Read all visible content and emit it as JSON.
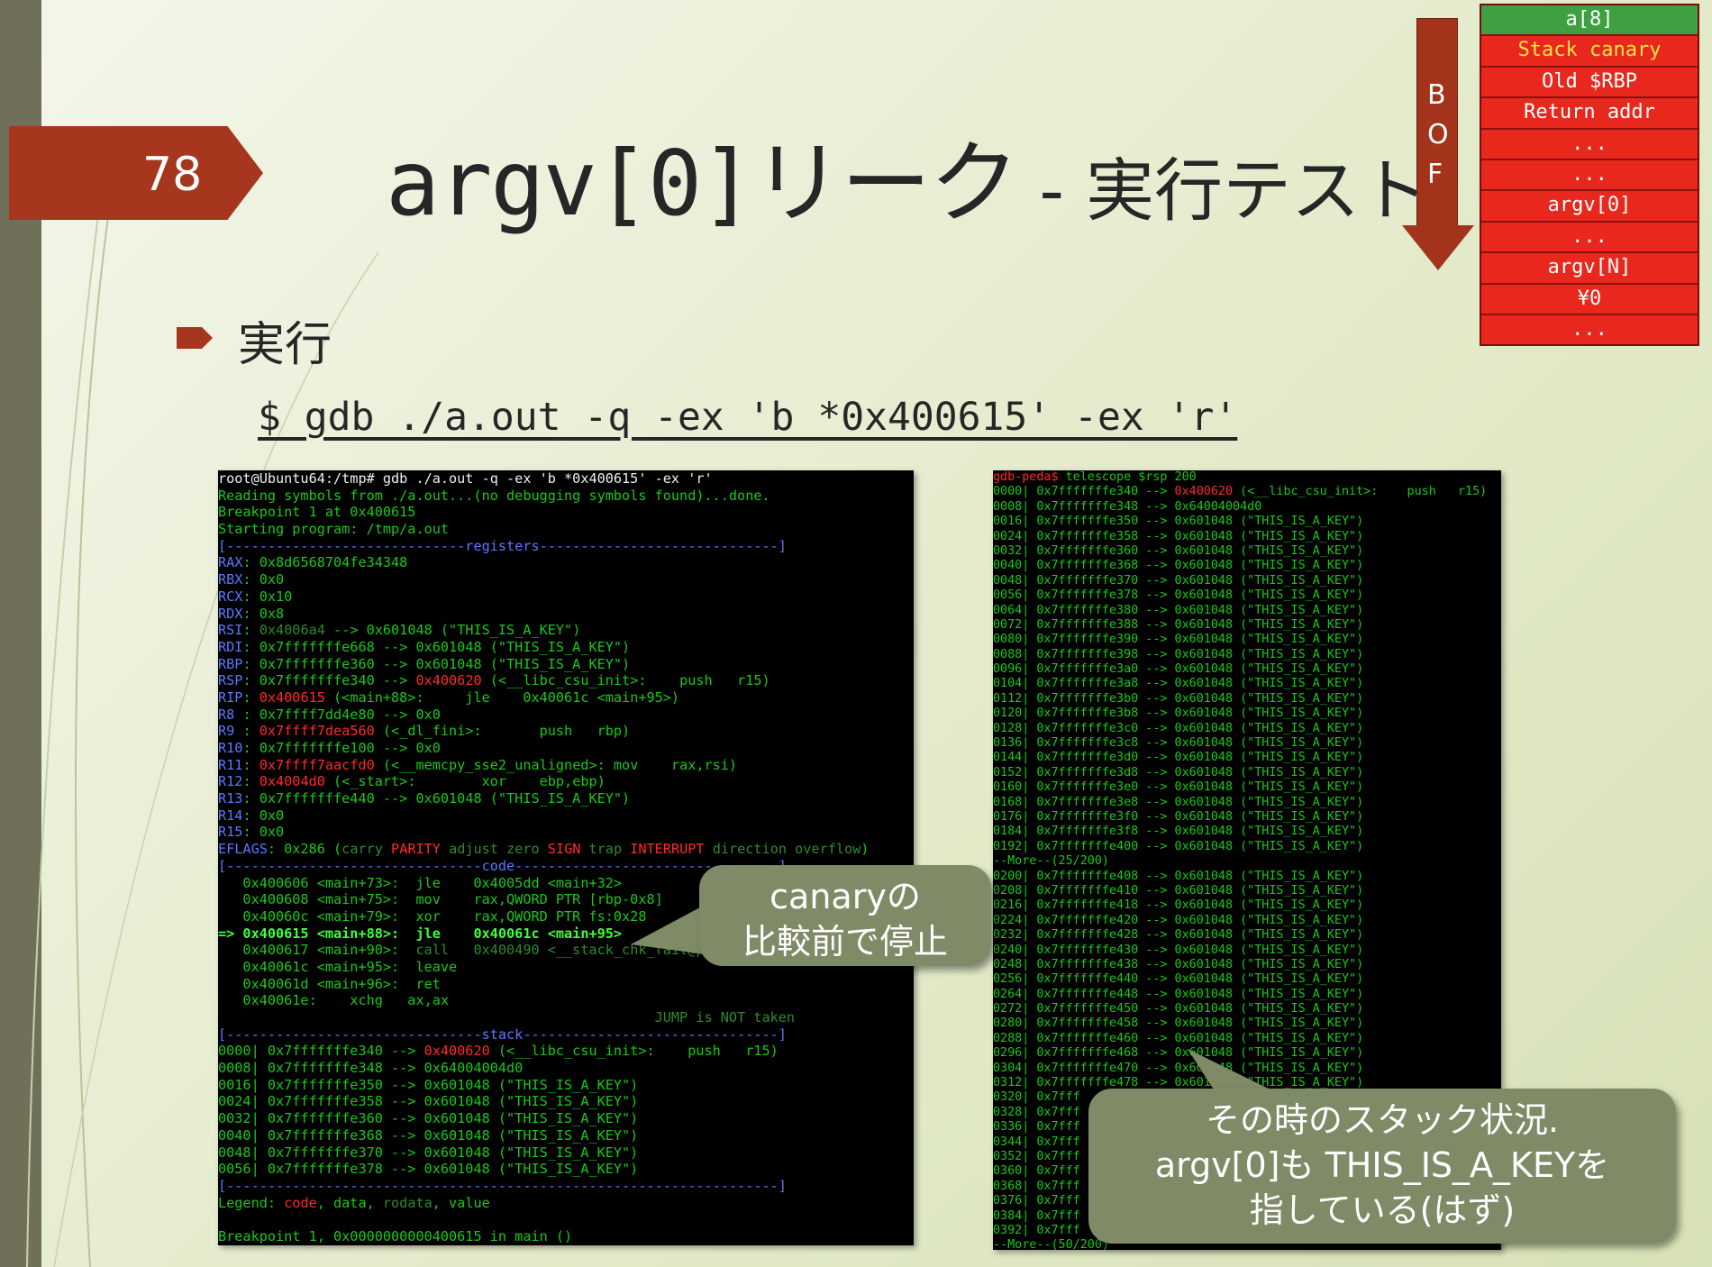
{
  "slide": {
    "number": "78",
    "title_main": "argv[0]リーク",
    "title_sub": "- 実行テスト",
    "bullet": "実行",
    "command": "$ gdb ./a.out -q -ex 'b *0x400615' -ex 'r'"
  },
  "colors": {
    "accent": "#a6361d",
    "callout": "#7f8a66",
    "stack_red": "#e8281c",
    "stack_green": "#3f9f42"
  },
  "terminal_left": [
    [
      [
        "white",
        "root@Ubuntu64:/tmp# gdb ./a.out -q -ex 'b *0x400615' -ex 'r'"
      ]
    ],
    [
      [
        "green",
        "Reading symbols from ./a.out...(no debugging symbols found)...done."
      ]
    ],
    [
      [
        "green",
        "Breakpoint 1 at 0x400615"
      ]
    ],
    [
      [
        "green",
        "Starting program: /tmp/a.out"
      ]
    ],
    [
      [
        "blue",
        "[-----------------------------registers-----------------------------]"
      ]
    ],
    [
      [
        "blue",
        "RAX"
      ],
      [
        "green",
        ": 0x8d6568704fe34348"
      ]
    ],
    [
      [
        "blue",
        "RBX"
      ],
      [
        "green",
        ": 0x0"
      ]
    ],
    [
      [
        "blue",
        "RCX"
      ],
      [
        "green",
        ": 0x10"
      ]
    ],
    [
      [
        "blue",
        "RDX"
      ],
      [
        "green",
        ": 0x8"
      ]
    ],
    [
      [
        "blue",
        "RSI"
      ],
      [
        "green",
        ": "
      ],
      [
        "dim",
        "0x4006a4"
      ],
      [
        "green",
        " --> 0x601048 (\"THIS_IS_A_KEY\")"
      ]
    ],
    [
      [
        "blue",
        "RDI"
      ],
      [
        "green",
        ": 0x7fffffffe668 --> 0x601048 (\"THIS_IS_A_KEY\")"
      ]
    ],
    [
      [
        "blue",
        "RBP"
      ],
      [
        "green",
        ": 0x7fffffffe360 --> 0x601048 (\"THIS_IS_A_KEY\")"
      ]
    ],
    [
      [
        "blue",
        "RSP"
      ],
      [
        "green",
        ": 0x7fffffffe340 --> "
      ],
      [
        "red",
        "0x400620"
      ],
      [
        "green",
        " (<__libc_csu_init>:    push   r15)"
      ]
    ],
    [
      [
        "blue",
        "RIP"
      ],
      [
        "green",
        ": "
      ],
      [
        "red",
        "0x400615"
      ],
      [
        "green",
        " (<main+88>:     jle    0x40061c <main+95>)"
      ]
    ],
    [
      [
        "blue",
        "R8 "
      ],
      [
        "green",
        ": 0x7ffff7dd4e80 --> 0x0"
      ]
    ],
    [
      [
        "blue",
        "R9 "
      ],
      [
        "green",
        ": "
      ],
      [
        "red",
        "0x7ffff7dea560"
      ],
      [
        "green",
        " (<_dl_fini>:       push   rbp)"
      ]
    ],
    [
      [
        "blue",
        "R10"
      ],
      [
        "green",
        ": 0x7fffffffe100 --> 0x0"
      ]
    ],
    [
      [
        "blue",
        "R11"
      ],
      [
        "green",
        ": "
      ],
      [
        "red",
        "0x7ffff7aacfd0"
      ],
      [
        "green",
        " (<__memcpy_sse2_unaligned>: mov    rax,rsi)"
      ]
    ],
    [
      [
        "blue",
        "R12"
      ],
      [
        "green",
        ": "
      ],
      [
        "red",
        "0x4004d0"
      ],
      [
        "green",
        " (<_start>:        xor    ebp,ebp)"
      ]
    ],
    [
      [
        "blue",
        "R13"
      ],
      [
        "green",
        ": 0x7fffffffe440 --> 0x601048 (\"THIS_IS_A_KEY\")"
      ]
    ],
    [
      [
        "blue",
        "R14"
      ],
      [
        "green",
        ": 0x0"
      ]
    ],
    [
      [
        "blue",
        "R15"
      ],
      [
        "green",
        ": 0x0"
      ]
    ],
    [
      [
        "blue",
        "EFLAGS"
      ],
      [
        "green",
        ": 0x286 ("
      ],
      [
        "dim",
        "carry "
      ],
      [
        "red",
        "PARITY"
      ],
      [
        "dim",
        " adjust zero "
      ],
      [
        "red",
        "SIGN"
      ],
      [
        "dim",
        " trap "
      ],
      [
        "red",
        "INTERRUPT"
      ],
      [
        "dim",
        " direction overflow"
      ],
      [
        "green",
        ")"
      ]
    ],
    [
      [
        "blue",
        "[-------------------------------code--------------------------------]"
      ]
    ],
    [
      [
        "green",
        "   0x400606 <main+73>:  jle    0x4005dd <main+32>"
      ]
    ],
    [
      [
        "green",
        "   0x400608 <main+75>:  mov    rax,QWORD PTR [rbp-0x8]"
      ]
    ],
    [
      [
        "green",
        "   0x40060c <main+79>:  xor    rax,QWORD PTR fs:0x28"
      ]
    ],
    [
      [
        "bold",
        "=> 0x400615 <main+88>:  jle    0x40061c <main+95>"
      ]
    ],
    [
      [
        "green",
        "   0x400617 <main+90>:  "
      ],
      [
        "dim",
        "call   0x400490 <__stack_chk_fail@plt>"
      ]
    ],
    [
      [
        "green",
        "   0x40061c <main+95>:  leave"
      ]
    ],
    [
      [
        "green",
        "   0x40061d <main+96>:  ret"
      ]
    ],
    [
      [
        "green",
        "   0x40061e:    xchg   ax,ax"
      ]
    ],
    [
      [
        "dim",
        "                                                     JUMP is NOT taken"
      ]
    ],
    [
      [
        "blue",
        "[-------------------------------stack-------------------------------]"
      ]
    ],
    [
      [
        "green",
        "0000| 0x7fffffffe340 --> "
      ],
      [
        "red",
        "0x400620"
      ],
      [
        "green",
        " (<__libc_csu_init>:    push   r15)"
      ]
    ],
    [
      [
        "green",
        "0008| 0x7fffffffe348 --> 0x64004004d0"
      ]
    ],
    [
      [
        "green",
        "0016| 0x7fffffffe350 --> 0x601048 (\"THIS_IS_A_KEY\")"
      ]
    ],
    [
      [
        "green",
        "0024| 0x7fffffffe358 --> 0x601048 (\"THIS_IS_A_KEY\")"
      ]
    ],
    [
      [
        "green",
        "0032| 0x7fffffffe360 --> 0x601048 (\"THIS_IS_A_KEY\")"
      ]
    ],
    [
      [
        "green",
        "0040| 0x7fffffffe368 --> 0x601048 (\"THIS_IS_A_KEY\")"
      ]
    ],
    [
      [
        "green",
        "0048| 0x7fffffffe370 --> 0x601048 (\"THIS_IS_A_KEY\")"
      ]
    ],
    [
      [
        "green",
        "0056| 0x7fffffffe378 --> 0x601048 (\"THIS_IS_A_KEY\")"
      ]
    ],
    [
      [
        "blue",
        "[-------------------------------------------------------------------]"
      ]
    ],
    [
      [
        "green",
        "Legend: "
      ],
      [
        "red",
        "code"
      ],
      [
        "green",
        ", data, "
      ],
      [
        "dim",
        "rodata"
      ],
      [
        "green",
        ", value"
      ]
    ],
    [
      [
        "green",
        ""
      ]
    ],
    [
      [
        "green",
        "Breakpoint 1, 0x0000000000400615 in main ()"
      ]
    ]
  ],
  "terminal_right": [
    [
      [
        "red",
        "gdb-peda$ "
      ],
      [
        "green",
        "telescope $rsp 200"
      ]
    ],
    [
      [
        "green",
        "0000| 0x7fffffffe340 --> "
      ],
      [
        "red",
        "0x400620"
      ],
      [
        "green",
        " (<__libc_csu_init>:    push   r15)"
      ]
    ],
    [
      [
        "green",
        "0008| 0x7fffffffe348 --> 0x64004004d0"
      ]
    ],
    [
      [
        "green",
        "0016| 0x7fffffffe350 --> 0x601048 (\"THIS_IS_A_KEY\")"
      ]
    ],
    [
      [
        "green",
        "0024| 0x7fffffffe358 --> 0x601048 (\"THIS_IS_A_KEY\")"
      ]
    ],
    [
      [
        "green",
        "0032| 0x7fffffffe360 --> 0x601048 (\"THIS_IS_A_KEY\")"
      ]
    ],
    [
      [
        "green",
        "0040| 0x7fffffffe368 --> 0x601048 (\"THIS_IS_A_KEY\")"
      ]
    ],
    [
      [
        "green",
        "0048| 0x7fffffffe370 --> 0x601048 (\"THIS_IS_A_KEY\")"
      ]
    ],
    [
      [
        "green",
        "0056| 0x7fffffffe378 --> 0x601048 (\"THIS_IS_A_KEY\")"
      ]
    ],
    [
      [
        "green",
        "0064| 0x7fffffffe380 --> 0x601048 (\"THIS_IS_A_KEY\")"
      ]
    ],
    [
      [
        "green",
        "0072| 0x7fffffffe388 --> 0x601048 (\"THIS_IS_A_KEY\")"
      ]
    ],
    [
      [
        "green",
        "0080| 0x7fffffffe390 --> 0x601048 (\"THIS_IS_A_KEY\")"
      ]
    ],
    [
      [
        "green",
        "0088| 0x7fffffffe398 --> 0x601048 (\"THIS_IS_A_KEY\")"
      ]
    ],
    [
      [
        "green",
        "0096| 0x7fffffffe3a0 --> 0x601048 (\"THIS_IS_A_KEY\")"
      ]
    ],
    [
      [
        "green",
        "0104| 0x7fffffffe3a8 --> 0x601048 (\"THIS_IS_A_KEY\")"
      ]
    ],
    [
      [
        "green",
        "0112| 0x7fffffffe3b0 --> 0x601048 (\"THIS_IS_A_KEY\")"
      ]
    ],
    [
      [
        "green",
        "0120| 0x7fffffffe3b8 --> 0x601048 (\"THIS_IS_A_KEY\")"
      ]
    ],
    [
      [
        "green",
        "0128| 0x7fffffffe3c0 --> 0x601048 (\"THIS_IS_A_KEY\")"
      ]
    ],
    [
      [
        "green",
        "0136| 0x7fffffffe3c8 --> 0x601048 (\"THIS_IS_A_KEY\")"
      ]
    ],
    [
      [
        "green",
        "0144| 0x7fffffffe3d0 --> 0x601048 (\"THIS_IS_A_KEY\")"
      ]
    ],
    [
      [
        "green",
        "0152| 0x7fffffffe3d8 --> 0x601048 (\"THIS_IS_A_KEY\")"
      ]
    ],
    [
      [
        "green",
        "0160| 0x7fffffffe3e0 --> 0x601048 (\"THIS_IS_A_KEY\")"
      ]
    ],
    [
      [
        "green",
        "0168| 0x7fffffffe3e8 --> 0x601048 (\"THIS_IS_A_KEY\")"
      ]
    ],
    [
      [
        "green",
        "0176| 0x7fffffffe3f0 --> 0x601048 (\"THIS_IS_A_KEY\")"
      ]
    ],
    [
      [
        "green",
        "0184| 0x7fffffffe3f8 --> 0x601048 (\"THIS_IS_A_KEY\")"
      ]
    ],
    [
      [
        "green",
        "0192| 0x7fffffffe400 --> 0x601048 (\"THIS_IS_A_KEY\")"
      ]
    ],
    [
      [
        "green",
        "--More--(25/200)"
      ]
    ],
    [
      [
        "green",
        "0200| 0x7fffffffe408 --> 0x601048 (\"THIS_IS_A_KEY\")"
      ]
    ],
    [
      [
        "green",
        "0208| 0x7fffffffe410 --> 0x601048 (\"THIS_IS_A_KEY\")"
      ]
    ],
    [
      [
        "green",
        "0216| 0x7fffffffe418 --> 0x601048 (\"THIS_IS_A_KEY\")"
      ]
    ],
    [
      [
        "green",
        "0224| 0x7fffffffe420 --> 0x601048 (\"THIS_IS_A_KEY\")"
      ]
    ],
    [
      [
        "green",
        "0232| 0x7fffffffe428 --> 0x601048 (\"THIS_IS_A_KEY\")"
      ]
    ],
    [
      [
        "green",
        "0240| 0x7fffffffe430 --> 0x601048 (\"THIS_IS_A_KEY\")"
      ]
    ],
    [
      [
        "green",
        "0248| 0x7fffffffe438 --> 0x601048 (\"THIS_IS_A_KEY\")"
      ]
    ],
    [
      [
        "green",
        "0256| 0x7fffffffe440 --> 0x601048 (\"THIS_IS_A_KEY\")"
      ]
    ],
    [
      [
        "green",
        "0264| 0x7fffffffe448 --> 0x601048 (\"THIS_IS_A_KEY\")"
      ]
    ],
    [
      [
        "green",
        "0272| 0x7fffffffe450 --> 0x601048 (\"THIS_IS_A_KEY\")"
      ]
    ],
    [
      [
        "green",
        "0280| 0x7fffffffe458 --> 0x601048 (\"THIS_IS_A_KEY\")"
      ]
    ],
    [
      [
        "green",
        "0288| 0x7fffffffe460 --> 0x601048 (\"THIS_IS_A_KEY\")"
      ]
    ],
    [
      [
        "green",
        "0296| 0x7fffffffe468 --> 0x601048 (\"THIS_IS_A_KEY\")"
      ]
    ],
    [
      [
        "green",
        "0304| 0x7fffffffe470 --> 0x601048 (\"THIS_IS_A_KEY\")"
      ]
    ],
    [
      [
        "green",
        "0312| 0x7fffffffe478 --> 0x601048 (\"THIS_IS_A_KEY\")"
      ]
    ],
    [
      [
        "green",
        "0320| 0x7fff"
      ]
    ],
    [
      [
        "green",
        "0328| 0x7fff"
      ]
    ],
    [
      [
        "green",
        "0336| 0x7fff"
      ]
    ],
    [
      [
        "green",
        "0344| 0x7fff"
      ]
    ],
    [
      [
        "green",
        "0352| 0x7fff"
      ]
    ],
    [
      [
        "green",
        "0360| 0x7fff"
      ]
    ],
    [
      [
        "green",
        "0368| 0x7fff"
      ]
    ],
    [
      [
        "green",
        "0376| 0x7fff"
      ]
    ],
    [
      [
        "green",
        "0384| 0x7fff"
      ]
    ],
    [
      [
        "green",
        "0392| 0x7fff"
      ]
    ],
    [
      [
        "green",
        "--More--(50/200)"
      ]
    ]
  ],
  "bof_arrow": {
    "letters": [
      "B",
      "O",
      "F"
    ]
  },
  "stack_diagram": [
    {
      "label": "a[8]",
      "style": "green"
    },
    {
      "label": "Stack canary",
      "style": "yellow"
    },
    {
      "label": "Old $RBP",
      "style": "red"
    },
    {
      "label": "Return addr",
      "style": "red"
    },
    {
      "label": "...",
      "style": "red"
    },
    {
      "label": "...",
      "style": "red"
    },
    {
      "label": "argv[0]",
      "style": "red"
    },
    {
      "label": "...",
      "style": "red"
    },
    {
      "label": "argv[N]",
      "style": "red"
    },
    {
      "label": "¥0",
      "style": "red"
    },
    {
      "label": "...",
      "style": "red"
    }
  ],
  "callouts": {
    "canary_lines": [
      "canaryの",
      "比較前で停止"
    ],
    "stack_lines": [
      "その時のスタック状況.",
      "argv[0]も THIS_IS_A_KEYを",
      "指している(はず)"
    ]
  }
}
